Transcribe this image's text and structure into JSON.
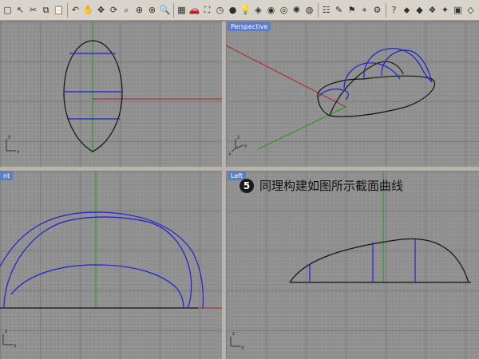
{
  "toolbar": {
    "icons": [
      {
        "name": "select-icon",
        "glyph": "▢"
      },
      {
        "name": "pointer-icon",
        "glyph": "↖"
      },
      {
        "name": "cut-icon",
        "glyph": "✂"
      },
      {
        "name": "copy-icon",
        "glyph": "⧉"
      },
      {
        "name": "paste-icon",
        "glyph": "📋"
      },
      {
        "name": "undo-icon",
        "glyph": "↶"
      },
      {
        "name": "hand-icon",
        "glyph": "✋"
      },
      {
        "name": "pan-icon",
        "glyph": "✥"
      },
      {
        "name": "rotate-icon",
        "glyph": "⟳"
      },
      {
        "name": "zoom-window-icon",
        "glyph": "⌕"
      },
      {
        "name": "zoom-extents-icon",
        "glyph": "⊕"
      },
      {
        "name": "zoom-selected-icon",
        "glyph": "⊗"
      },
      {
        "name": "zoom-icon",
        "glyph": "🔍"
      },
      {
        "name": "grid-icon",
        "glyph": "▦"
      },
      {
        "name": "car-icon",
        "glyph": "🚗"
      },
      {
        "name": "perspective-icon",
        "glyph": "⛶"
      },
      {
        "name": "cplane-icon",
        "glyph": "◷"
      },
      {
        "name": "shade-icon",
        "glyph": "●"
      },
      {
        "name": "light-icon",
        "glyph": "💡"
      },
      {
        "name": "layer-icon",
        "glyph": "◈"
      },
      {
        "name": "material-icon",
        "glyph": "◉"
      },
      {
        "name": "render-icon",
        "glyph": "◎"
      },
      {
        "name": "color-wheel-icon",
        "glyph": "✺"
      },
      {
        "name": "sphere-icon",
        "glyph": "◍"
      },
      {
        "name": "properties-icon",
        "glyph": "☷"
      },
      {
        "name": "pen-icon",
        "glyph": "✎"
      },
      {
        "name": "flag-icon",
        "glyph": "⚑"
      },
      {
        "name": "snap-icon",
        "glyph": "⌖"
      },
      {
        "name": "options-icon",
        "glyph": "⚙"
      },
      {
        "name": "help-icon",
        "glyph": "?"
      },
      {
        "name": "tag-icon",
        "glyph": "⬥"
      },
      {
        "name": "gold-icon",
        "glyph": "◆"
      },
      {
        "name": "bookmark-icon",
        "glyph": "❖"
      },
      {
        "name": "star-icon",
        "glyph": "✦"
      },
      {
        "name": "cube-icon",
        "glyph": "▣"
      },
      {
        "name": "tag2-icon",
        "glyph": "◇"
      },
      {
        "name": "extra-icon",
        "glyph": "▤"
      }
    ]
  },
  "viewports": {
    "top": {
      "label": ""
    },
    "perspective": {
      "label": "Perspective"
    },
    "front": {
      "label": "nt"
    },
    "left": {
      "label": "Left"
    }
  },
  "axis_labels": {
    "x": "x",
    "y": "y",
    "z": "z"
  },
  "caption": {
    "number": "5",
    "text": "同理构建如图所示截面曲线"
  },
  "colors": {
    "curve": "#111111",
    "section": "#1f1fd0",
    "x_axis": "#b42020",
    "y_axis": "#1e9a1e",
    "label_bg": "#5a7fc4"
  }
}
